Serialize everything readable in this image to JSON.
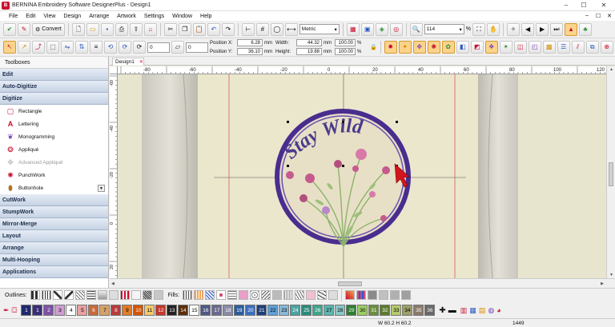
{
  "window": {
    "title": "BERNINA Embroidery Software DesignerPlus - Design1",
    "min": "–",
    "max": "☐",
    "close": "✕"
  },
  "menu": {
    "items": [
      "File",
      "Edit",
      "View",
      "Design",
      "Arrange",
      "Artwork",
      "Settings",
      "Window",
      "Help"
    ]
  },
  "toolbar": {
    "convert_label": "Convert",
    "spin1": "0",
    "spin2": "0",
    "units": "Metric",
    "zoom": "114",
    "zoom_unit": "%"
  },
  "position": {
    "x_label": "Position X:",
    "x_value": "6.28",
    "y_label": "Position Y:",
    "y_value": "36.10",
    "unit": "mm"
  },
  "size": {
    "width_label": "Width:",
    "width_value": "44.32",
    "height_label": "Height:",
    "height_value": "19.88",
    "unit": "mm",
    "width_pct": "100.00",
    "height_pct": "100.00",
    "pct": "%"
  },
  "toolbox": {
    "title": "Toolboxes",
    "categories_top": [
      "Edit",
      "Auto-Digitize",
      "Digitize"
    ],
    "digitize_tools": [
      {
        "label": "Rectangle",
        "icon": "rectangle-icon"
      },
      {
        "label": "Lettering",
        "icon": "lettering-icon"
      },
      {
        "label": "Monogramming",
        "icon": "monogram-icon"
      },
      {
        "label": "Appliqué",
        "icon": "applique-icon"
      },
      {
        "label": "Advanced Appliqué",
        "icon": "advanced-applique-icon"
      },
      {
        "label": "PunchWork",
        "icon": "punchwork-icon"
      },
      {
        "label": "Buttonhole",
        "icon": "buttonhole-icon"
      }
    ],
    "categories_bottom": [
      "CutWork",
      "StumpWork",
      "Mirror-Merge",
      "Layout",
      "Arrange",
      "Multi-Hooping",
      "Applications"
    ]
  },
  "document": {
    "tab": "Design1"
  },
  "ruler": {
    "h_labels": [
      "-80",
      "-60",
      "-40",
      "-20",
      "0",
      "20",
      "40",
      "60",
      "80",
      "100",
      "120"
    ],
    "v_labels": [
      "-60",
      "-40",
      "-20",
      "0",
      "20",
      "40"
    ]
  },
  "design": {
    "text": "Stay Wild",
    "ring_color": "#4a2d8f",
    "text_color": "#4a3b8c",
    "stem_color": "#8db36b",
    "flower_color": "#c65a8e",
    "bg_color": "#ebe7cd"
  },
  "bottom": {
    "outlines_label": "Outlines:",
    "fills_label": "Fills:",
    "colors": [
      {
        "n": "1",
        "bg": "#1f2a6e",
        "fg": "#fff"
      },
      {
        "n": "1",
        "bg": "#3a2d78",
        "fg": "#fff"
      },
      {
        "n": "2",
        "bg": "#7d52a3",
        "fg": "#fff"
      },
      {
        "n": "3",
        "bg": "#d09bd0",
        "fg": "#000"
      },
      {
        "n": "4",
        "bg": "#ffffff",
        "fg": "#000"
      },
      {
        "n": "5",
        "bg": "#e8a0a0",
        "fg": "#000"
      },
      {
        "n": "6",
        "bg": "#c96a3a",
        "fg": "#fff"
      },
      {
        "n": "7",
        "bg": "#d4a36a",
        "fg": "#000"
      },
      {
        "n": "8",
        "bg": "#b83a3a",
        "fg": "#fff"
      },
      {
        "n": "9",
        "bg": "#e07b2a",
        "fg": "#000"
      },
      {
        "n": "10",
        "bg": "#d35400",
        "fg": "#fff"
      },
      {
        "n": "11",
        "bg": "#f3c96b",
        "fg": "#000"
      },
      {
        "n": "12",
        "bg": "#c0392b",
        "fg": "#fff"
      },
      {
        "n": "13",
        "bg": "#222222",
        "fg": "#fff"
      },
      {
        "n": "14",
        "bg": "#5a2d0c",
        "fg": "#fff"
      },
      {
        "n": "15",
        "bg": "#ffffff",
        "fg": "#000"
      },
      {
        "n": "16",
        "bg": "#4d5a86",
        "fg": "#fff"
      },
      {
        "n": "17",
        "bg": "#6b6b8f",
        "fg": "#fff"
      },
      {
        "n": "18",
        "bg": "#8a8aa8",
        "fg": "#fff"
      },
      {
        "n": "19",
        "bg": "#2c5e9e",
        "fg": "#fff"
      },
      {
        "n": "20",
        "bg": "#3b6fbf",
        "fg": "#fff"
      },
      {
        "n": "21",
        "bg": "#1f3f7a",
        "fg": "#fff"
      },
      {
        "n": "22",
        "bg": "#5ea0d6",
        "fg": "#000"
      },
      {
        "n": "23",
        "bg": "#88b8d8",
        "fg": "#000"
      },
      {
        "n": "24",
        "bg": "#4aa3a0",
        "fg": "#fff"
      },
      {
        "n": "25",
        "bg": "#2d8a7a",
        "fg": "#fff"
      },
      {
        "n": "26",
        "bg": "#3fa58a",
        "fg": "#fff"
      },
      {
        "n": "27",
        "bg": "#5bb5b0",
        "fg": "#000"
      },
      {
        "n": "28",
        "bg": "#8ac6c4",
        "fg": "#000"
      },
      {
        "n": "29",
        "bg": "#2e7d32",
        "fg": "#fff"
      },
      {
        "n": "30",
        "bg": "#9ccc65",
        "fg": "#000"
      },
      {
        "n": "31",
        "bg": "#6a8f3a",
        "fg": "#fff"
      },
      {
        "n": "32",
        "bg": "#5d7a2e",
        "fg": "#fff"
      },
      {
        "n": "33",
        "bg": "#b4c96a",
        "fg": "#000"
      },
      {
        "n": "34",
        "bg": "#9e9e6a",
        "fg": "#000"
      },
      {
        "n": "35",
        "bg": "#8a7a6a",
        "fg": "#fff"
      },
      {
        "n": "36",
        "bg": "#6a6a6a",
        "fg": "#fff"
      }
    ]
  },
  "status": {
    "coords": "W 60.2 H 60.2",
    "count": "1449"
  }
}
